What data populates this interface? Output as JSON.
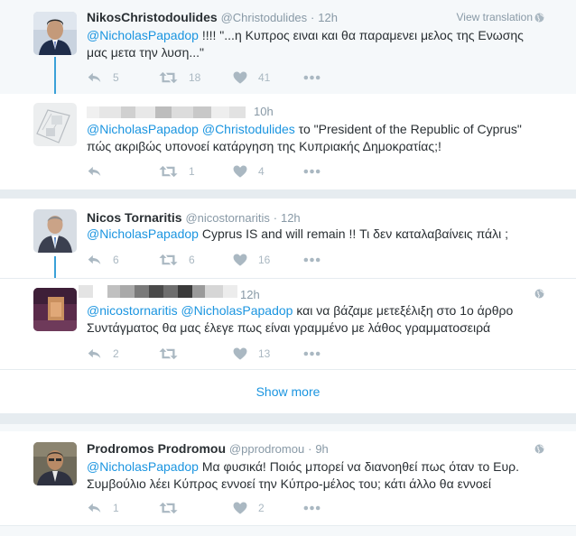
{
  "tweets": [
    {
      "name": "NikosChristodoulides",
      "handle": "@Christodulides",
      "dot": "·",
      "time": "12h",
      "view_translation": "View translation",
      "body_mention": "@NicholasPapadop",
      "body_text_1": " !!!! \"...η Κυπρος ειναι και θα παραμενει μελος της Ενωσης",
      "body_text_2": "μας μετα την λυση...\"",
      "replies": "5",
      "retweets": "18",
      "likes": "41"
    },
    {
      "time": "10h",
      "body_mention_1": "@NicholasPapadop",
      "body_mention_2": "@Christodulides",
      "body_text_1": " το \"President of the Republic of Cyprus\"",
      "body_text_2": "πώς ακριβώς υπονοεί κατάργηση της Κυπριακής Δημοκρατίας;!",
      "replies": "",
      "retweets": "1",
      "likes": "4"
    },
    {
      "name": "Nicos Tornaritis",
      "handle": "@nicostornaritis",
      "dot": "·",
      "time": "12h",
      "body_mention": "@NicholasPapadop",
      "body_text_1": " Cyprus IS and will remain  !! Τι δεν καταλαβαίνεις πάλι ;",
      "replies": "6",
      "retweets": "6",
      "likes": "16"
    },
    {
      "time": "12h",
      "body_mention_1": "@nicostornaritis",
      "body_mention_2": "@NicholasPapadop",
      "body_text_1": " και να βάζαμε μετεξέλιξη στο 1ο άρθρο",
      "body_text_2": "Συντάγματος θα μας έλεγε πως είναι γραμμένο με λάθος γραμματοσειρά",
      "replies": "2",
      "retweets": "",
      "likes": "13"
    },
    {
      "name": "Prodromos Prodromou",
      "handle": "@pprodromou",
      "dot": "·",
      "time": "9h",
      "body_mention": "@NicholasPapadop",
      "body_text_1": " Μα φυσικά! Ποιός μπορεί να διανοηθεί πως όταν το Ευρ.",
      "body_text_2": "Συμβούλιο λέει Κύπρος εννοεί την Κύπρο-μέλος του; κάτι άλλο θα εννοεί",
      "replies": "1",
      "retweets": "",
      "likes": "2"
    }
  ],
  "show_more": "Show more",
  "colors": {
    "link": "#1b95e0",
    "icon": "#aab8c2",
    "thread": "#3aa1d8",
    "meta": "#8899a6"
  },
  "icons": [
    "reply-icon",
    "retweet-icon",
    "heart-icon",
    "more-icon",
    "globe-icon"
  ]
}
